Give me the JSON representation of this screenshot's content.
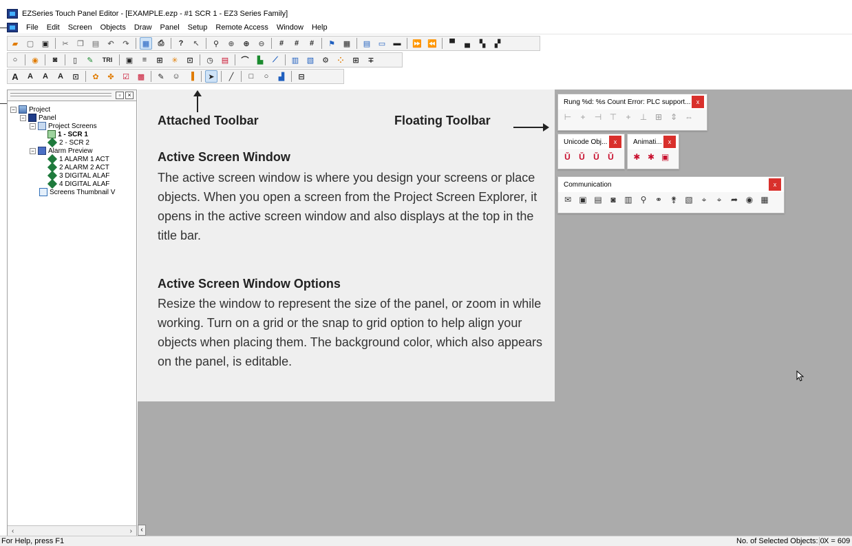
{
  "window": {
    "title": "EZSeries Touch Panel Editor - [EXAMPLE.ezp - #1 SCR 1 - EZ3 Series Family]"
  },
  "menu": {
    "items": [
      "File",
      "Edit",
      "Screen",
      "Objects",
      "Draw",
      "Panel",
      "Setup",
      "Remote Access",
      "Window",
      "Help"
    ]
  },
  "toolbar": {
    "row2_text_button": "TRI"
  },
  "explorer": {
    "tree": [
      {
        "label": "Project"
      },
      {
        "label": "Panel"
      },
      {
        "label": "Project Screens"
      },
      {
        "label": "1 - SCR 1"
      },
      {
        "label": "2 - SCR 2"
      },
      {
        "label": "Alarm Preview"
      },
      {
        "label": "1 ALARM 1 ACT"
      },
      {
        "label": "2 ALARM 2 ACT"
      },
      {
        "label": "3 DIGITAL ALAF"
      },
      {
        "label": "4 DIGITAL ALAF"
      },
      {
        "label": "Screens Thumbnail V"
      }
    ]
  },
  "annotations": {
    "attached_toolbar": "Attached Toolbar",
    "floating_toolbar": "Floating Toolbar",
    "active_screen_window_heading": "Active Screen Window",
    "active_screen_window_body": "The active screen window is where you design your screens or place objects. When you open a screen from the Project Screen Explorer, it opens in the active screen window and also displays at the top in the title bar.",
    "options_heading": "Active Screen Window Options",
    "options_body": "Resize the window to represent the size of the panel, or zoom in while working. Turn on a grid or the snap to grid option to help align your objects when placing them. The background color, which also appears on the panel, is editable."
  },
  "floating_windows": {
    "rung": {
      "title": "Rung %d: %s Count Error: PLC support...",
      "close": "x"
    },
    "unicode": {
      "title": "Unicode Obj...",
      "close": "x"
    },
    "animation": {
      "title": "Animati...",
      "close": "x"
    },
    "communication": {
      "title": "Communication",
      "close": "x"
    }
  },
  "status": {
    "help": "For Help, press F1",
    "selected": "No. of Selected Objects: 0",
    "x": "X = 609"
  },
  "colors": {
    "workspace": "#ababab",
    "callout": "#efefef",
    "close_button": "#d9302c"
  }
}
